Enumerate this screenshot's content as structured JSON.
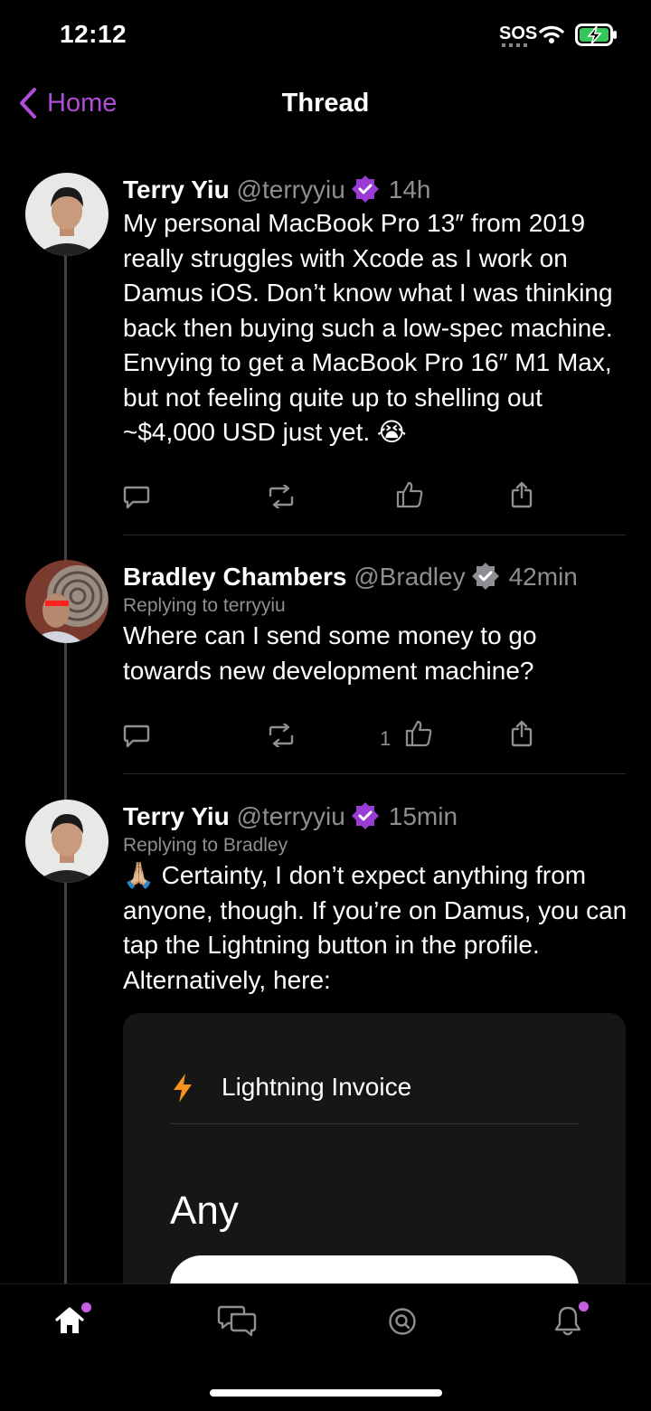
{
  "status": {
    "time": "12:12",
    "sos": "SOS"
  },
  "nav": {
    "back_label": "Home",
    "title": "Thread"
  },
  "posts": [
    {
      "name": "Terry Yiu",
      "handle": "@terryyiu",
      "time": "14h",
      "verified_color": "#9b3bd6",
      "text": "My personal MacBook Pro 13″ from 2019 really struggles with Xcode as I work on Damus iOS. Don’t know what I was thinking back then buying such a low-spec machine. Envying to get a MacBook Pro 16″ M1 Max, but not feeling quite up to shelling out ~$4,000 USD just yet. 😭"
    },
    {
      "name": "Bradley Chambers",
      "handle": "@Bradley",
      "time": "42min",
      "verified_color": "#8e8e93",
      "reply_to": "Replying to terryyiu",
      "text": "Where can I send some money to go towards new development machine?",
      "like_count": "1"
    },
    {
      "name": "Terry Yiu",
      "handle": "@terryyiu",
      "time": "15min",
      "verified_color": "#9b3bd6",
      "reply_to": "Replying to Bradley",
      "text": "🙏🏼 Certainty, I don’t expect anything from anyone, though. If you’re on Damus, you can tap the Lightning button in the profile. Alternatively, here:"
    }
  ],
  "invoice": {
    "title": "Lightning Invoice",
    "amount": "Any",
    "bolt_color": "#f7931a"
  },
  "colors": {
    "accent": "#b04cd8",
    "badge_dot": "#c85fe0"
  },
  "tabs": [
    "home-icon",
    "dms-icon",
    "search-icon",
    "notifications-icon"
  ]
}
